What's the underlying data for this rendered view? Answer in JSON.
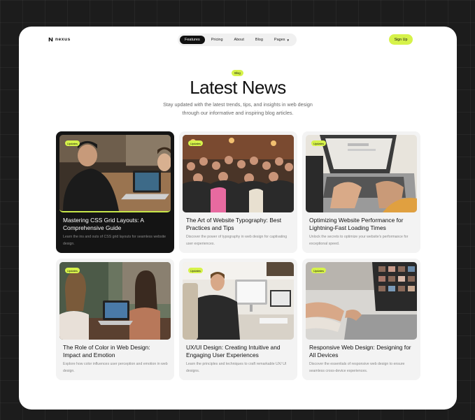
{
  "brand": {
    "name": "nexus"
  },
  "nav": {
    "items": [
      {
        "label": "Features",
        "active": true
      },
      {
        "label": "Pricing"
      },
      {
        "label": "About"
      },
      {
        "label": "Blog"
      },
      {
        "label": "Pages",
        "dropdown": true
      }
    ],
    "signup_label": "Sign Up"
  },
  "hero": {
    "badge": "Blog",
    "title": "Latest News",
    "subtitle": "Stay updated with the latest trends, tips, and insights in web design through our informative and inspiring blog articles."
  },
  "posts": [
    {
      "tag": "Updates",
      "title": "Mastering CSS Grid Layouts: A Comprehensive Guide",
      "description": "Learn the ins and outs of CSS grid layouts for seamless website design.",
      "image": "man-laptop-photo"
    },
    {
      "tag": "Updates",
      "title": "The Art of Website Typography: Best Practices and Tips",
      "description": "Discover the power of typography in web design for captivating user experiences.",
      "image": "crowd-photo"
    },
    {
      "tag": "Updates",
      "title": "Optimizing Website Performance for Lightning-Fast Loading Times",
      "description": "Unlock the secrets to optimize your website's performance for exceptional speed.",
      "image": "typing-laptop-photo"
    },
    {
      "tag": "Updates",
      "title": "The Role of Color in Web Design: Impact and Emotion",
      "description": "Explore how color influences user perception and emotion in web design.",
      "image": "women-laptop-photo"
    },
    {
      "tag": "Updates",
      "title": "UX/UI Design: Creating Intuitive and Engaging User Experiences",
      "description": "Learn the principles and techniques to craft remarkable UX/ UI designs.",
      "image": "desk-workstation-photo"
    },
    {
      "tag": "Updates",
      "title": "Responsive Web Design: Designing for All Devices",
      "description": "Discover the essentials of responsive web design to ensure seamless cross-device experiences.",
      "image": "hands-laptop-photo"
    }
  ],
  "colors": {
    "accent": "#d6f24a",
    "dark_card": "#141414",
    "card_bg": "#f3f3f3"
  }
}
